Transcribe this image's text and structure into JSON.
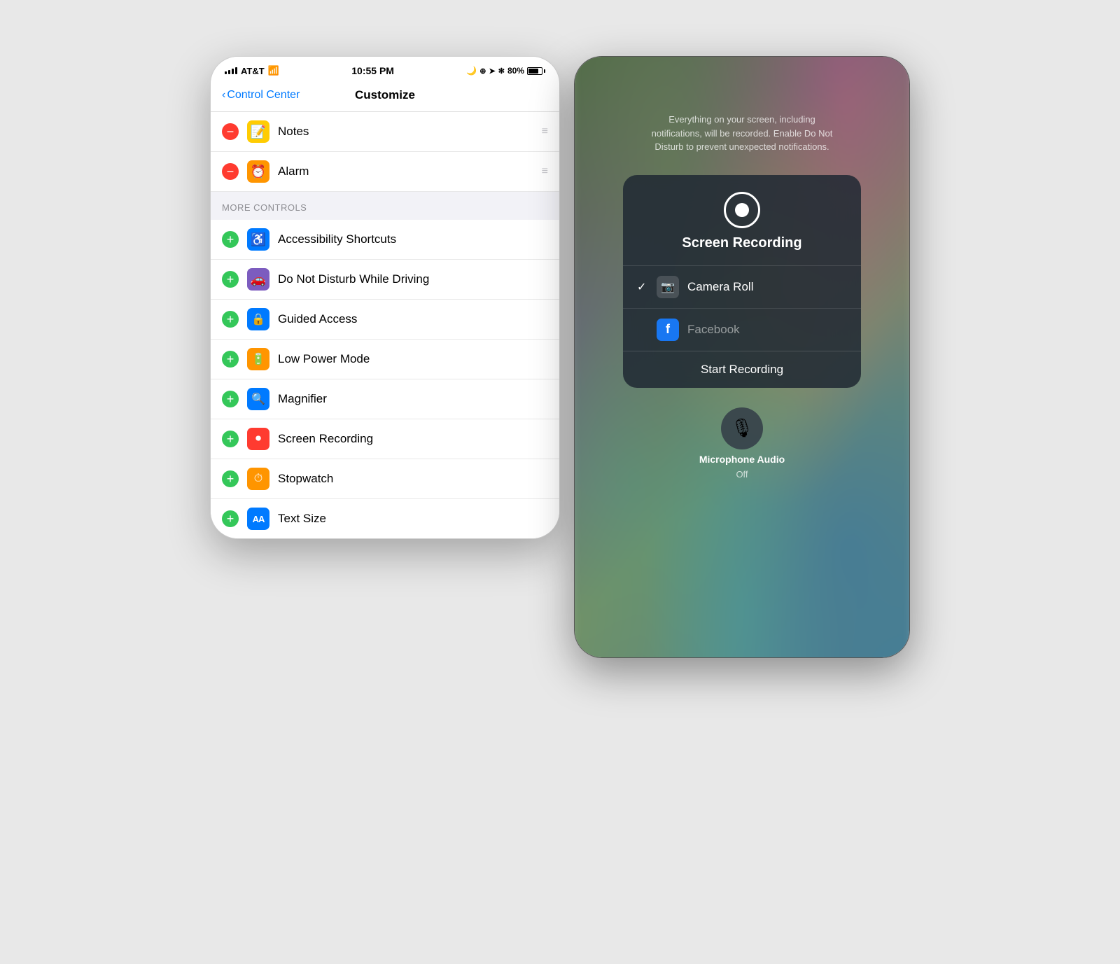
{
  "left_panel": {
    "status_bar": {
      "carrier": "AT&T",
      "time": "10:55 PM",
      "battery_pct": "80%"
    },
    "nav": {
      "back_label": "Control Center",
      "title": "Customize"
    },
    "included_items": [
      {
        "id": "notes",
        "label": "Notes",
        "icon": "📝",
        "icon_bg": "yellow"
      },
      {
        "id": "alarm",
        "label": "Alarm",
        "icon": "⏰",
        "icon_bg": "orange-alarm"
      }
    ],
    "more_controls_header": "MORE CONTROLS",
    "more_controls": [
      {
        "id": "accessibility",
        "label": "Accessibility Shortcuts",
        "icon": "♿",
        "icon_bg": "blue"
      },
      {
        "id": "dnd-driving",
        "label": "Do Not Disturb While Driving",
        "icon": "🚗",
        "icon_bg": "purple"
      },
      {
        "id": "guided-access",
        "label": "Guided Access",
        "icon": "🔒",
        "icon_bg": "blue-lock"
      },
      {
        "id": "low-power",
        "label": "Low Power Mode",
        "icon": "🔋",
        "icon_bg": "orange-power"
      },
      {
        "id": "magnifier",
        "label": "Magnifier",
        "icon": "🔍",
        "icon_bg": "blue-mag"
      },
      {
        "id": "screen-recording",
        "label": "Screen Recording",
        "icon": "⏺",
        "icon_bg": "red"
      },
      {
        "id": "stopwatch",
        "label": "Stopwatch",
        "icon": "⏱",
        "icon_bg": "orange-stop"
      },
      {
        "id": "text-size",
        "label": "Text Size",
        "icon": "AA",
        "icon_bg": "blue-aa"
      }
    ]
  },
  "right_panel": {
    "info_text": "Everything on your screen, including notifications, will be recorded. Enable Do Not Disturb to prevent unexpected notifications.",
    "modal": {
      "title": "Screen Recording",
      "options": [
        {
          "id": "camera-roll",
          "label": "Camera Roll",
          "checked": true,
          "icon": "📷"
        },
        {
          "id": "facebook",
          "label": "Facebook",
          "checked": false,
          "icon": "f"
        }
      ],
      "start_button": "Start Recording"
    },
    "microphone": {
      "label": "Microphone Audio",
      "status": "Off"
    }
  }
}
